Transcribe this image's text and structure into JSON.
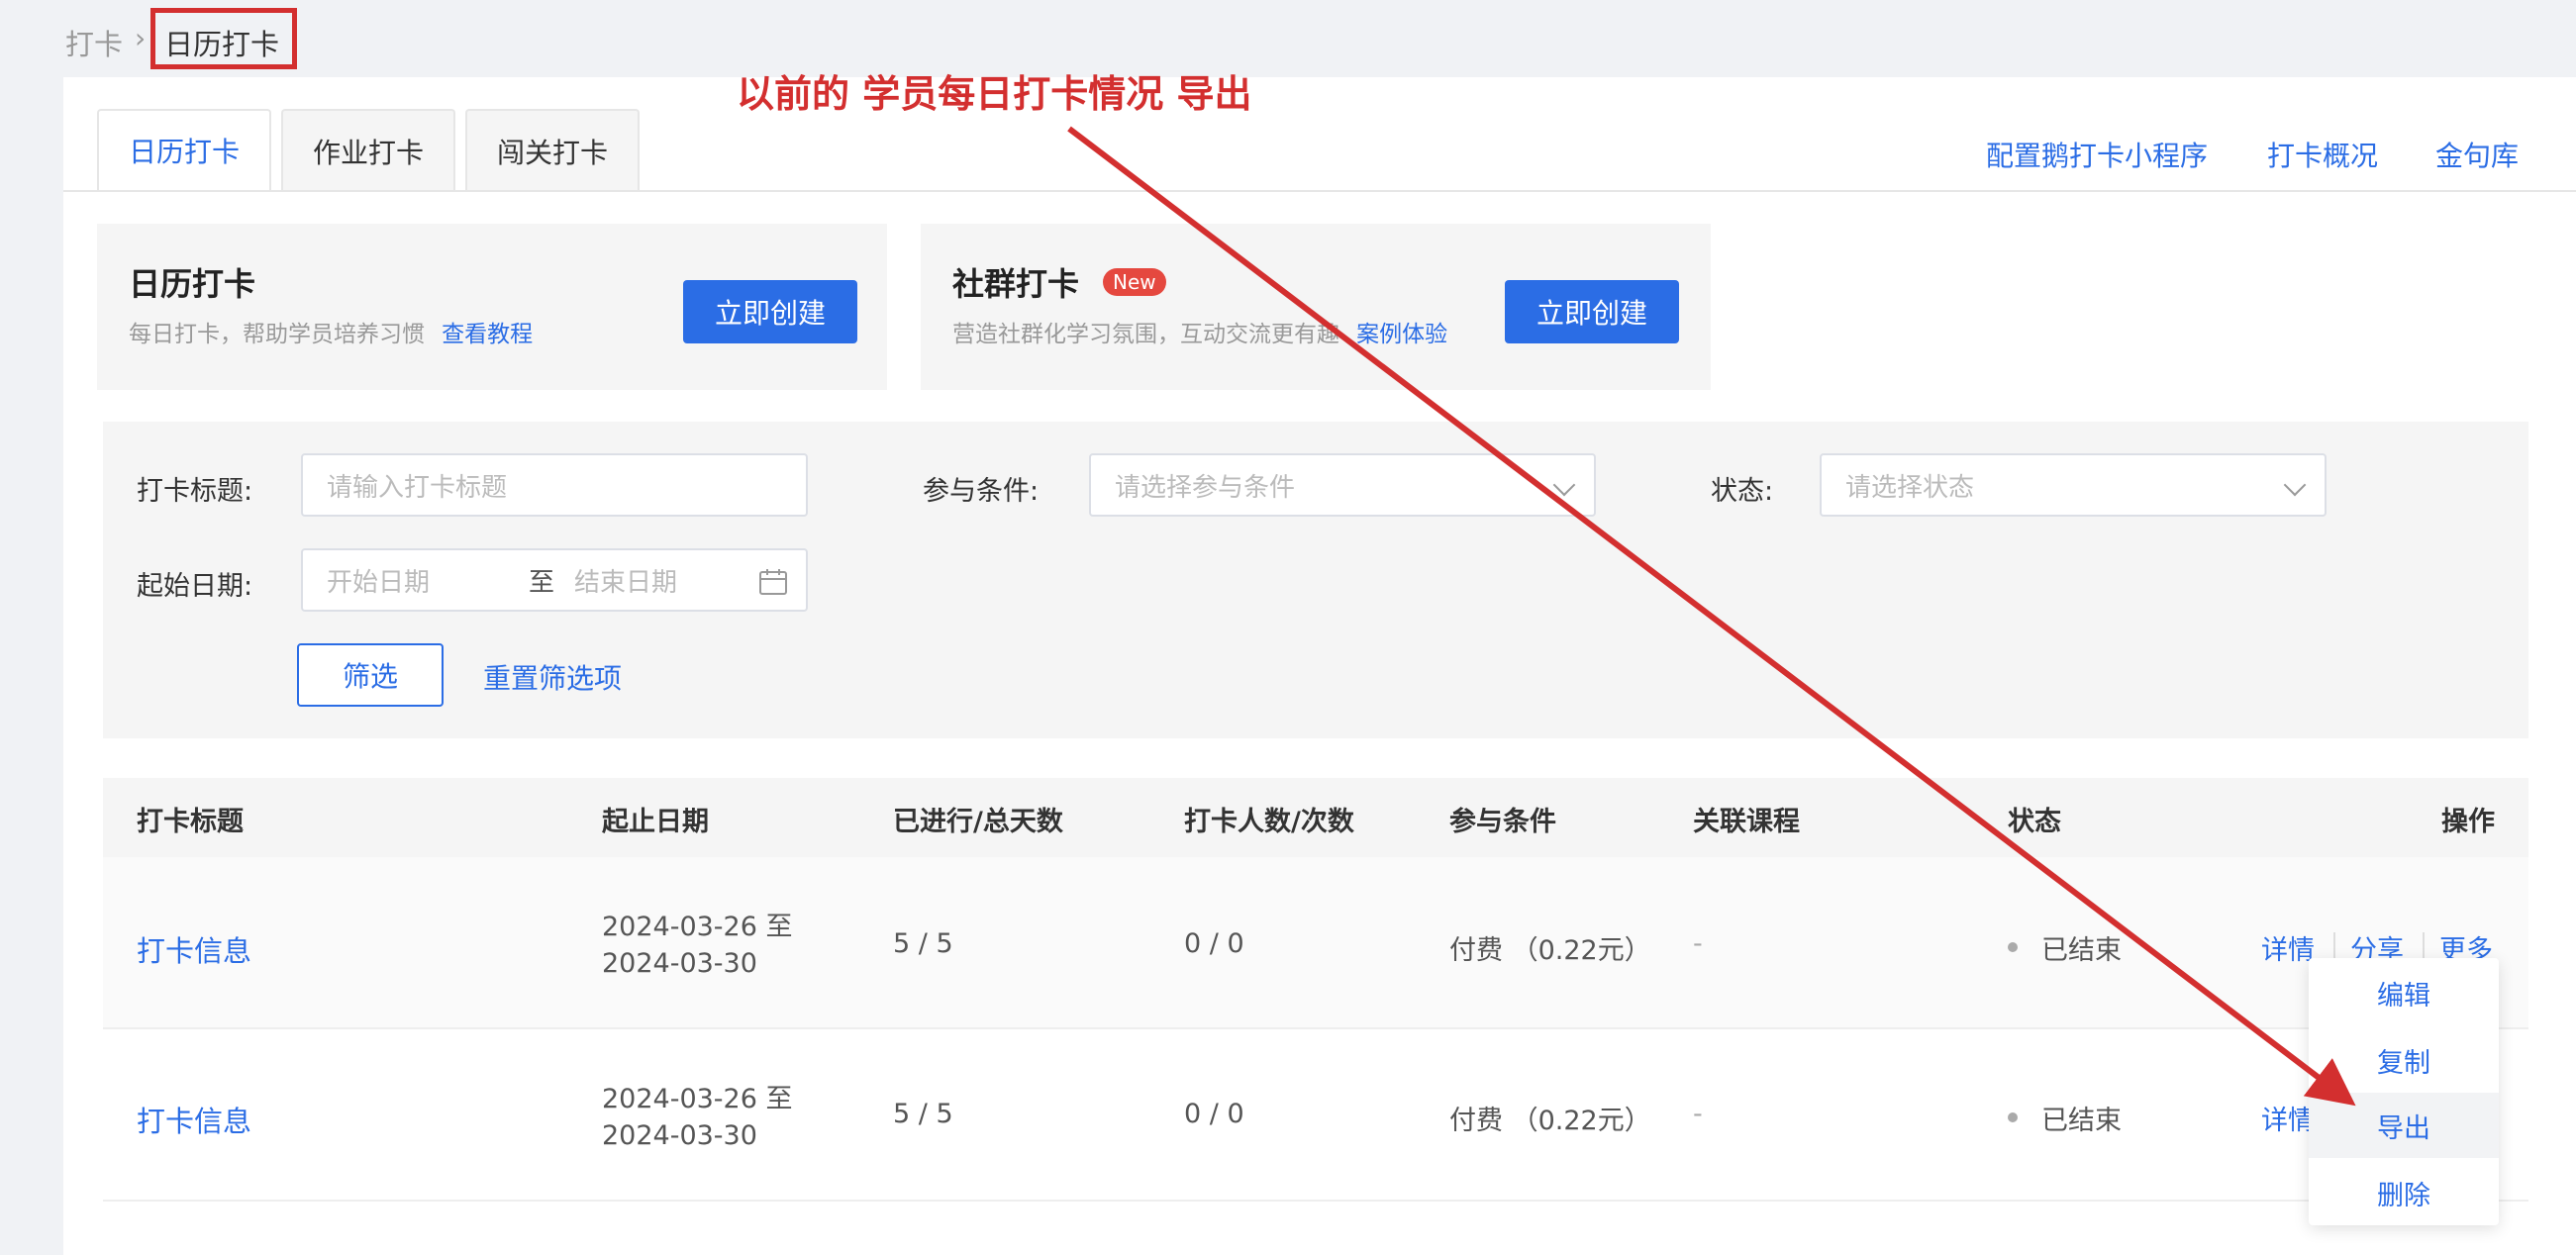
{
  "breadcrumb": {
    "root": "打卡",
    "current": "日历打卡"
  },
  "tabs": [
    {
      "label": "日历打卡",
      "active": true
    },
    {
      "label": "作业打卡",
      "active": false
    },
    {
      "label": "闯关打卡",
      "active": false
    }
  ],
  "top_links": [
    "配置鹅打卡小程序",
    "打卡概况",
    "金句库"
  ],
  "promos": [
    {
      "title": "日历打卡",
      "subtitle": "每日打卡，帮助学员培养习惯",
      "link": "查看教程",
      "button": "立即创建"
    },
    {
      "title": "社群打卡",
      "badge": "New",
      "subtitle": "营造社群化学习氛围，互动交流更有趣",
      "link": "案例体验",
      "button": "立即创建"
    }
  ],
  "filters": {
    "title_label": "打卡标题:",
    "title_placeholder": "请输入打卡标题",
    "condition_label": "参与条件:",
    "condition_placeholder": "请选择参与条件",
    "status_label": "状态:",
    "status_placeholder": "请选择状态",
    "date_label": "起始日期:",
    "start_placeholder": "开始日期",
    "date_sep": "至",
    "end_placeholder": "结束日期",
    "filter_button": "筛选",
    "reset_link": "重置筛选项"
  },
  "table": {
    "headers": [
      "打卡标题",
      "起止日期",
      "已进行/总天数",
      "打卡人数/次数",
      "参与条件",
      "关联课程",
      "状态",
      "操作"
    ],
    "rows": [
      {
        "title": "打卡信息",
        "date_start": "2024-03-26 至",
        "date_end": "2024-03-30",
        "progress": "5 / 5",
        "people": "0 / 0",
        "condition": "付费 （0.22元）",
        "course": "-",
        "status": "已结束",
        "ops": [
          "详情",
          "分享",
          "更多"
        ]
      },
      {
        "title": "打卡信息",
        "date_start": "2024-03-26 至",
        "date_end": "2024-03-30",
        "progress": "5 / 5",
        "people": "0 / 0",
        "condition": "付费 （0.22元）",
        "course": "-",
        "status": "已结束",
        "ops": [
          "详情"
        ]
      }
    ]
  },
  "more_menu": [
    "编辑",
    "复制",
    "导出",
    "删除"
  ],
  "annotation": {
    "text": "以前的 学员每日打卡情况 导出",
    "color": "#d32f2f"
  },
  "colors": {
    "accent": "#2b6de5",
    "annotation": "#d32f2f",
    "badge": "#e5483f"
  }
}
